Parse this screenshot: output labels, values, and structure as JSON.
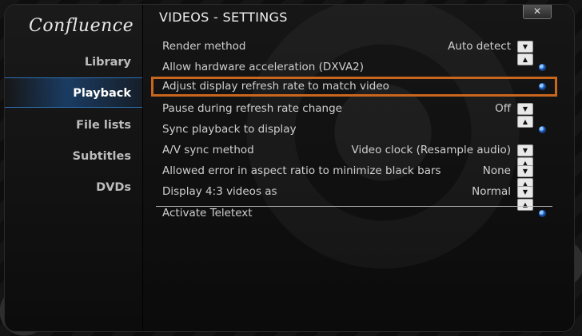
{
  "app": {
    "logo_text": "Confluence"
  },
  "window": {
    "title": "VIDEOS - SETTINGS",
    "close_label": "✕"
  },
  "sidebar": {
    "items": [
      {
        "label": "Library",
        "active": false
      },
      {
        "label": "Playback",
        "active": true
      },
      {
        "label": "File lists",
        "active": false
      },
      {
        "label": "Subtitles",
        "active": false
      },
      {
        "label": "DVDs",
        "active": false
      }
    ]
  },
  "settings": [
    {
      "label": "Render method",
      "value": "Auto detect",
      "control": "spinner"
    },
    {
      "label": "Allow hardware acceleration (DXVA2)",
      "value": "",
      "control": "toggle-on"
    },
    {
      "label": "Adjust display refresh rate to match video",
      "value": "",
      "control": "toggle-on",
      "highlighted": true
    },
    {
      "label": "Pause during refresh rate change",
      "value": "Off",
      "control": "spinner"
    },
    {
      "label": "Sync playback to display",
      "value": "",
      "control": "toggle-on"
    },
    {
      "label": "A/V sync method",
      "value": "Video clock (Resample audio)",
      "control": "spinner"
    },
    {
      "label": "Allowed error in aspect ratio to minimize black bars",
      "value": "None",
      "control": "spinner"
    },
    {
      "label": "Display 4:3 videos as",
      "value": "Normal",
      "control": "spinner"
    },
    {
      "label": "Activate Teletext",
      "value": "",
      "control": "toggle-on"
    }
  ],
  "spinner": {
    "down": "▼",
    "up": "▲"
  },
  "colors": {
    "highlight_border": "#c8661d",
    "accent": "#2a72d6"
  }
}
